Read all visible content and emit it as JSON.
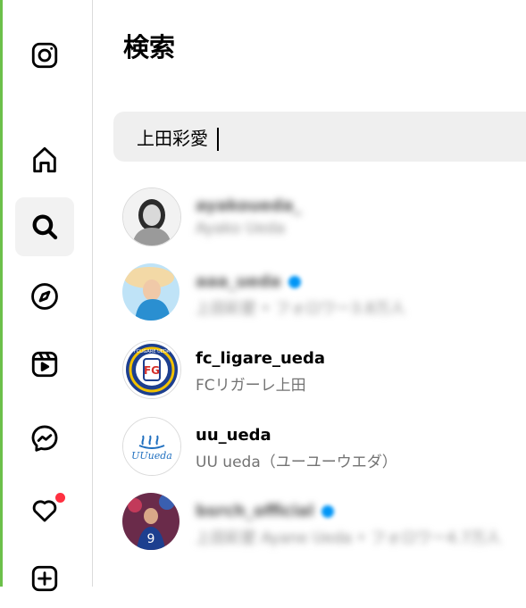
{
  "sidebar": {
    "items": [
      {
        "name": "instagram-logo-icon"
      },
      {
        "name": "home-icon"
      },
      {
        "name": "search-icon"
      },
      {
        "name": "explore-icon"
      },
      {
        "name": "reels-icon"
      },
      {
        "name": "messenger-icon"
      },
      {
        "name": "notifications-heart-icon"
      },
      {
        "name": "create-plus-icon"
      }
    ],
    "active": "search-icon"
  },
  "page": {
    "title": "検索"
  },
  "search": {
    "value": "上田彩愛"
  },
  "results": [
    {
      "username": "ayakoueda_",
      "fullname": "Ayako Ueda",
      "blurred": true,
      "verified": false
    },
    {
      "username": "aaa_ueda",
      "fullname": "上田彩愛 • フォロワー3.8万人",
      "blurred": true,
      "verified": true
    },
    {
      "username": "fc_ligare_ueda",
      "fullname": "FCリガーレ上田",
      "blurred": false,
      "verified": false
    },
    {
      "username": "uu_ueda",
      "fullname": "UU ueda（ユーユーウエダ）",
      "blurred": false,
      "verified": false
    },
    {
      "username": "bsrch_official",
      "fullname": "上田彩愛 Ayane Ueda • フォロワー4.7万人",
      "blurred": true,
      "verified": true
    }
  ],
  "logo_text": {
    "uu_ueda": "UUueda",
    "fc_ligare_ueda": "FCLIGARE UEDA"
  },
  "colors": {
    "accent": "#0095f6",
    "notification": "#ff3040",
    "edge": "#6cc04a"
  }
}
